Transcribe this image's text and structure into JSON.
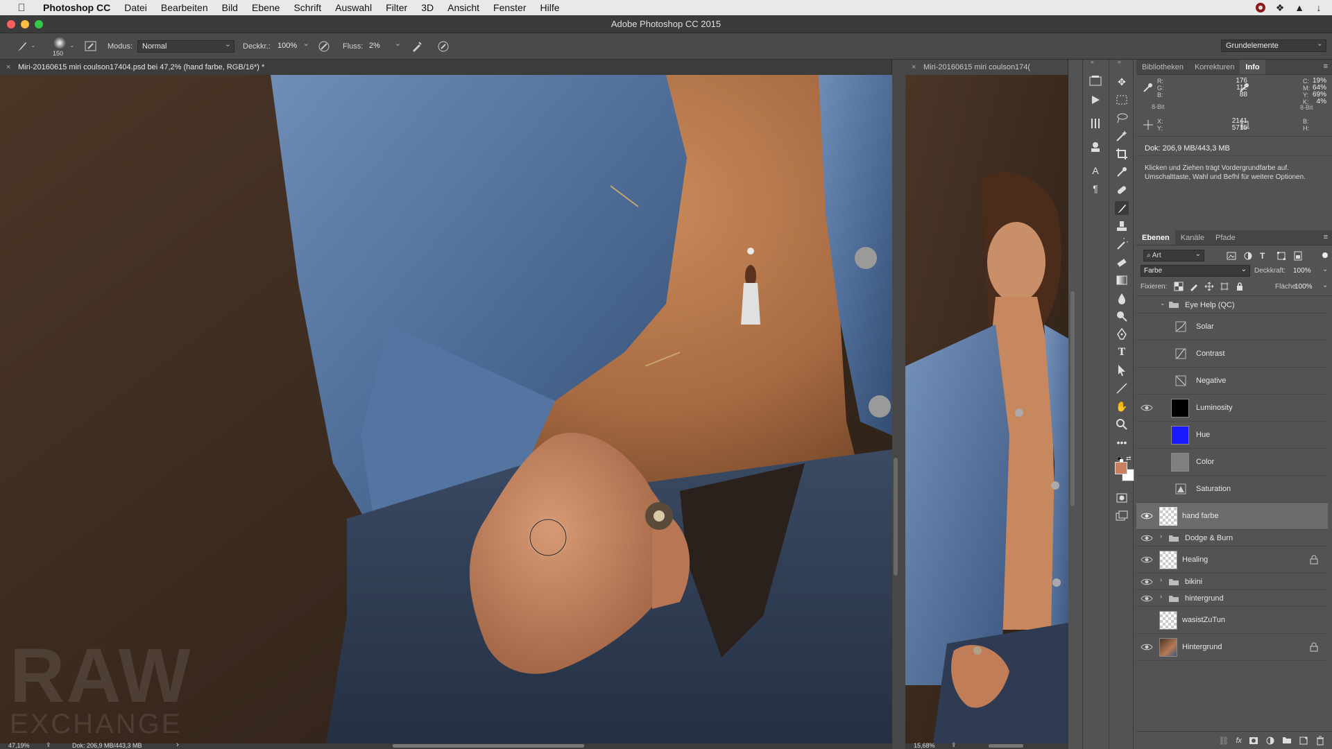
{
  "menubar": {
    "app": "Photoshop CC",
    "items": [
      "Datei",
      "Bearbeiten",
      "Bild",
      "Ebene",
      "Schrift",
      "Auswahl",
      "Filter",
      "3D",
      "Ansicht",
      "Fenster",
      "Hilfe"
    ]
  },
  "window": {
    "title": "Adobe Photoshop CC 2015"
  },
  "options": {
    "brush_size": "150",
    "mode_label": "Modus:",
    "mode_value": "Normal",
    "opacity_label": "Deckkr.:",
    "opacity_value": "100%",
    "flow_label": "Fluss:",
    "flow_value": "2%",
    "workspace": "Grundelemente"
  },
  "tabs": {
    "doc1": "Miri-20160615 miri coulson17404.psd bei 47,2% (hand farbe, RGB/16*) *",
    "doc2": "Miri-20160615 miri coulson174("
  },
  "canvas": {
    "watermark_line1": "RAW",
    "watermark_line2": "EXCHANGE"
  },
  "status": {
    "zoom1": "47,19%",
    "doc_info": "Dok: 206,9 MB/443,3 MB",
    "zoom2": "15,68%",
    "arrow": "›"
  },
  "info_panel": {
    "tabs": [
      "Bibliotheken",
      "Korrekturen",
      "Info"
    ],
    "active_tab": "Info",
    "rgb_labels": [
      "R:",
      "G:",
      "B:"
    ],
    "rgb_values": [
      "176",
      "112",
      "88"
    ],
    "cmyk_labels": [
      "C:",
      "M:",
      "Y:",
      "K:"
    ],
    "cmyk_values": [
      "19%",
      "64%",
      "69%",
      "4%"
    ],
    "bit_left": "8-Bit",
    "bit_right": "8-Bit",
    "xy_labels": [
      "X:",
      "Y:"
    ],
    "xy_values": [
      "2141",
      "5715"
    ],
    "bh_labels": [
      "B:",
      "H:"
    ],
    "doc": "Dok: 206,9 MB/443,3 MB",
    "hint": "Klicken und Ziehen trägt Vordergrundfarbe auf. Umschalttaste, Wahl und Befhl für weitere Optionen."
  },
  "layers_panel": {
    "tabs": [
      "Ebenen",
      "Kanäle",
      "Pfade"
    ],
    "active_tab": "Ebenen",
    "filter_kind": "Art",
    "blend_mode": "Farbe",
    "opacity_label": "Deckkraft:",
    "opacity_value": "100%",
    "lock_label": "Fixieren:",
    "fill_label": "Fläche:",
    "fill_value": "100%",
    "layers": [
      {
        "name": "Eye Help (QC)",
        "kind": "group",
        "visible": false,
        "expanded": true
      },
      {
        "name": "Solar",
        "kind": "curves",
        "visible": false
      },
      {
        "name": "Contrast",
        "kind": "curves",
        "visible": false
      },
      {
        "name": "Negative",
        "kind": "curves",
        "visible": false
      },
      {
        "name": "Luminosity",
        "kind": "fill",
        "visible": true,
        "color": "#000000"
      },
      {
        "name": "Hue",
        "kind": "fill",
        "visible": false,
        "color": "#1a1aff"
      },
      {
        "name": "Color",
        "kind": "fill",
        "visible": false,
        "color": "#808080"
      },
      {
        "name": "Saturation",
        "kind": "huesat",
        "visible": false
      },
      {
        "name": "hand farbe",
        "kind": "pixel",
        "visible": true,
        "selected": true
      },
      {
        "name": "Dodge & Burn",
        "kind": "group",
        "visible": true
      },
      {
        "name": "Healing",
        "kind": "pixel",
        "visible": true,
        "locked": true
      },
      {
        "name": "bikini",
        "kind": "group",
        "visible": true
      },
      {
        "name": "hintergrund",
        "kind": "group",
        "visible": true
      },
      {
        "name": "wasistZuTun",
        "kind": "pixel",
        "visible": false
      },
      {
        "name": "Hintergrund",
        "kind": "photo",
        "visible": true,
        "locked": true
      }
    ]
  },
  "colors": {
    "foreground": "#c9805f",
    "background": "#ffffff",
    "accent_selected": "#6c6c6c"
  }
}
